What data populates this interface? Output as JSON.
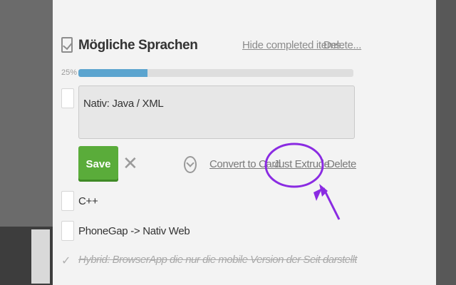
{
  "checklist": {
    "title": "Mögliche Sprachen",
    "hide_completed_label": "Hide completed items.",
    "delete_label": "Delete...",
    "progress_text": "25%",
    "progress_fraction": 0.25
  },
  "editor": {
    "value": "Nativ: Java / XML"
  },
  "actions": {
    "save_label": "Save",
    "cancel_icon": "close-icon",
    "due_icon": "clock-icon",
    "convert_label": "Convert to Card",
    "extrude_label": "Just Extrude",
    "delete_label": "Delete"
  },
  "items": [
    {
      "label": "C++",
      "checked": false
    },
    {
      "label": "PhoneGap -> Nativ Web",
      "checked": false
    },
    {
      "label": "Hybrid: BrowserApp die nur die mobile Version der Seit darstellt",
      "checked": true
    }
  ],
  "colors": {
    "progress": "#5ba4cf",
    "save_button": "#5aac3a",
    "annotation": "#8a2be2"
  }
}
